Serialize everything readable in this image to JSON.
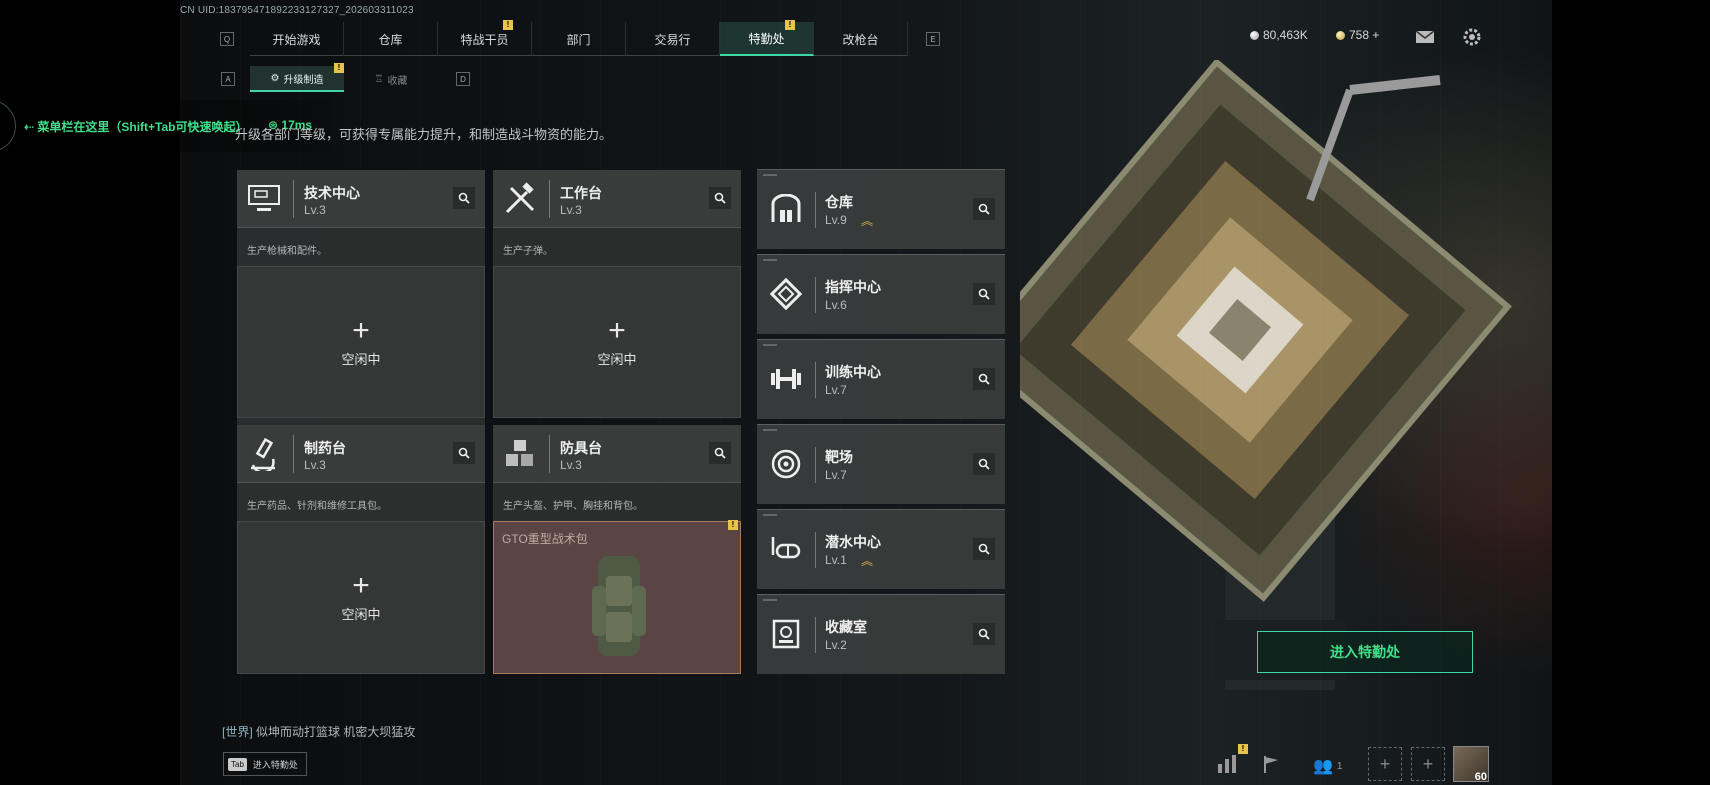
{
  "uid": "CN UID:1837954718922331273​27_202603311023",
  "nav": {
    "left_key": "Q",
    "right_key": "E",
    "tabs": [
      {
        "label": "开始游戏",
        "badge": false
      },
      {
        "label": "仓库",
        "badge": false
      },
      {
        "label": "特战干员",
        "badge": true
      },
      {
        "label": "部门",
        "badge": false
      },
      {
        "label": "交易行",
        "badge": false
      },
      {
        "label": "特勤处",
        "badge": true,
        "active": true
      },
      {
        "label": "改枪台",
        "badge": false
      }
    ],
    "badge_text": "!"
  },
  "subnav": {
    "left_key": "A",
    "right_key": "D",
    "tabs": [
      {
        "label": "升级制造",
        "active": true,
        "badge": true
      },
      {
        "label": "收藏",
        "active": false
      }
    ]
  },
  "currency": {
    "silver": "80,463K",
    "gold": "758 +"
  },
  "overlay": {
    "menu_hint": "菜单栏在这里（Shift+Tab可快速唤起）",
    "ping": "17ms"
  },
  "description": "升级各部门等级，可获得专属能力提升，和制造战斗物资的能力。",
  "stations": [
    {
      "name": "技术中心",
      "level": "Lv.3",
      "icon": "monitor-icon",
      "desc": "生产枪械和配件。",
      "slot": "idle"
    },
    {
      "name": "工作台",
      "level": "Lv.3",
      "icon": "tools-icon",
      "desc": "生产子弹。",
      "slot": "idle"
    },
    {
      "name": "制药台",
      "level": "Lv.3",
      "icon": "microscope-icon",
      "desc": "生产药品、针剂和维修工具包。",
      "slot": "idle"
    },
    {
      "name": "防具台",
      "level": "Lv.3",
      "icon": "cubes-icon",
      "desc": "生产头盔、护甲、胸挂和背包。",
      "slot": "item",
      "item_name": "GTO重型战术包"
    }
  ],
  "idle_label": "空闲中",
  "facilities": [
    {
      "name": "仓库",
      "level": "Lv.9",
      "icon": "warehouse-icon",
      "upgrade": true
    },
    {
      "name": "指挥中心",
      "level": "Lv.6",
      "icon": "command-icon",
      "upgrade": false
    },
    {
      "name": "训练中心",
      "level": "Lv.7",
      "icon": "dumbbell-icon",
      "upgrade": false
    },
    {
      "name": "靶场",
      "level": "Lv.7",
      "icon": "target-icon",
      "upgrade": false
    },
    {
      "name": "潜水中心",
      "level": "Lv.1",
      "icon": "diving-mask-icon",
      "upgrade": true
    },
    {
      "name": "收藏室",
      "level": "Lv.2",
      "icon": "collection-icon",
      "upgrade": false
    }
  ],
  "enter_button": "进入特勤处",
  "chat": {
    "channel": "[世界]",
    "message": "似坤而动打篮球 机密大坝猛攻"
  },
  "tab_hint": {
    "key": "Tab",
    "label": "进入特勤处"
  },
  "bottom_bar": {
    "friends_count": "1",
    "player_level": "60"
  },
  "colors": {
    "accent": "#3fd7a3",
    "badge": "#e8c44a",
    "hint_green": "#3fe08a"
  }
}
